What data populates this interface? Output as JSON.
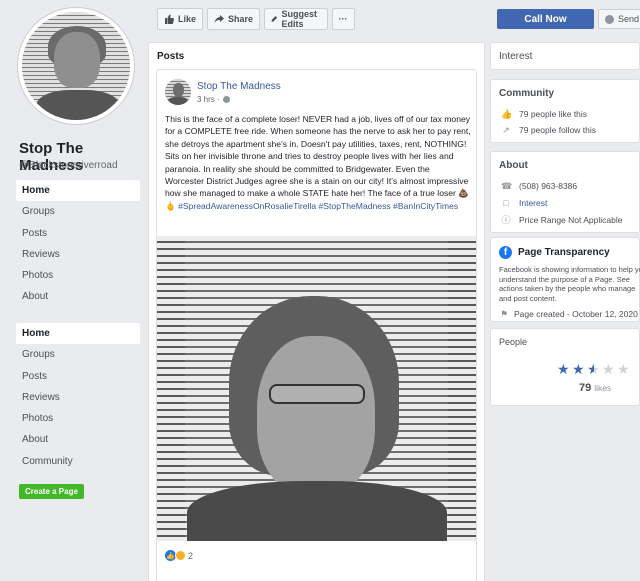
{
  "page": {
    "name": "Stop The Madness",
    "handle": "@Blackstoneriverroad"
  },
  "nav_primary": [
    "Home",
    "Groups",
    "Posts",
    "Reviews",
    "Photos",
    "About"
  ],
  "nav_secondary": [
    "Home",
    "Groups",
    "Posts",
    "Reviews",
    "Photos",
    "About",
    "Community"
  ],
  "create_page_label": "Create a Page",
  "actions": {
    "like": "Like",
    "share": "Share",
    "suggest_edits": "Suggest Edits",
    "more": "···",
    "call_now": "Call Now",
    "send": "Send"
  },
  "posts_section": {
    "label": "Posts",
    "post": {
      "author": "Stop The Madness",
      "time": "3 hrs ·",
      "text": "This is the face of a complete loser! NEVER had a job, lives off of our tax money for a COMPLETE free ride. When someone has the nerve to ask her to pay rent, she detroys the apartment she's in. Doesn't pay utilities, taxes, rent, NOTHING! Sits on her invisible throne and tries to destroy people lives with her lies and paranoia. In reality she should be committed to Bridgewater. Even the Worcester District Judges agree she is a stain on our city! It's almost impressive how she managed to make a whole STATE hate her! The face of a true loser 💩🖕",
      "hashtags": "#SpreadAwarenessOnRosalieTirella #StopTheMadness #BanInCityTimes",
      "reaction_count": "2"
    }
  },
  "sidebar": {
    "interest_title": "Interest",
    "community": {
      "title": "Community",
      "likes": "79 people like this",
      "follows": "79 people follow this"
    },
    "about": {
      "title": "About",
      "phone": "(508) 963-8386",
      "category": "Interest",
      "price_range": "Price Range Not Applicable"
    },
    "transparency": {
      "title": "Page Transparency",
      "description": "Facebook is showing information to help you understand the purpose of a Page. See actions taken by the people who manage and post content.",
      "created": "Page created - October 12, 2020"
    },
    "people": {
      "title": "People",
      "rating": 2.5,
      "rating_max": 5,
      "likes_count": "79",
      "likes_label": "likes"
    }
  },
  "colors": {
    "background": "#e9ebee",
    "brand_blue": "#4267b2",
    "link": "#385898",
    "create_green": "#42b72a"
  }
}
